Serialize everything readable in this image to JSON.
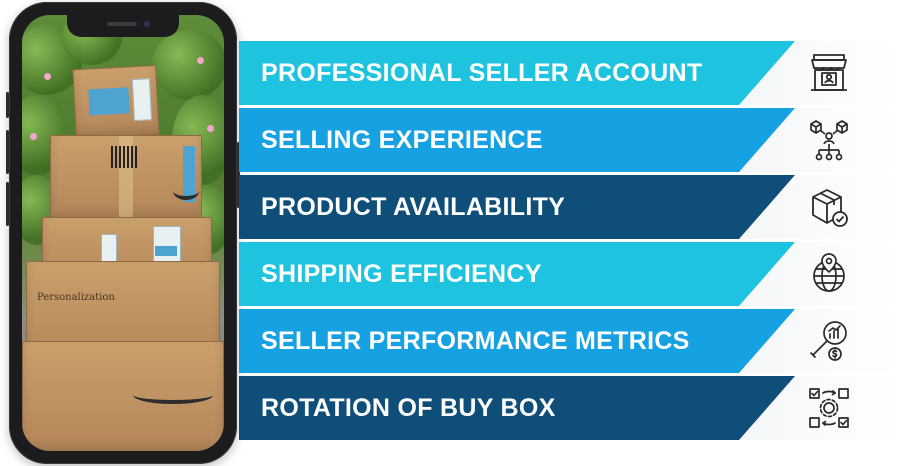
{
  "items": [
    {
      "label": "PROFESSIONAL SELLER ACCOUNT",
      "icon": "storefront-icon",
      "color": "#1ec3e0"
    },
    {
      "label": "SELLING EXPERIENCE",
      "icon": "network-boxes-icon",
      "color": "#16a1e2"
    },
    {
      "label": "PRODUCT AVAILABILITY",
      "icon": "box-check-icon",
      "color": "#104e7a"
    },
    {
      "label": "SHIPPING EFFICIENCY",
      "icon": "globe-pin-icon",
      "color": "#1ec3e0"
    },
    {
      "label": "SELLER PERFORMANCE METRICS",
      "icon": "magnifier-chart-icon",
      "color": "#16a1e2"
    },
    {
      "label": "ROTATION OF BUY BOX",
      "icon": "rotation-gear-icon",
      "color": "#104e7a"
    }
  ],
  "phone": {
    "box_print": "Personalization"
  }
}
